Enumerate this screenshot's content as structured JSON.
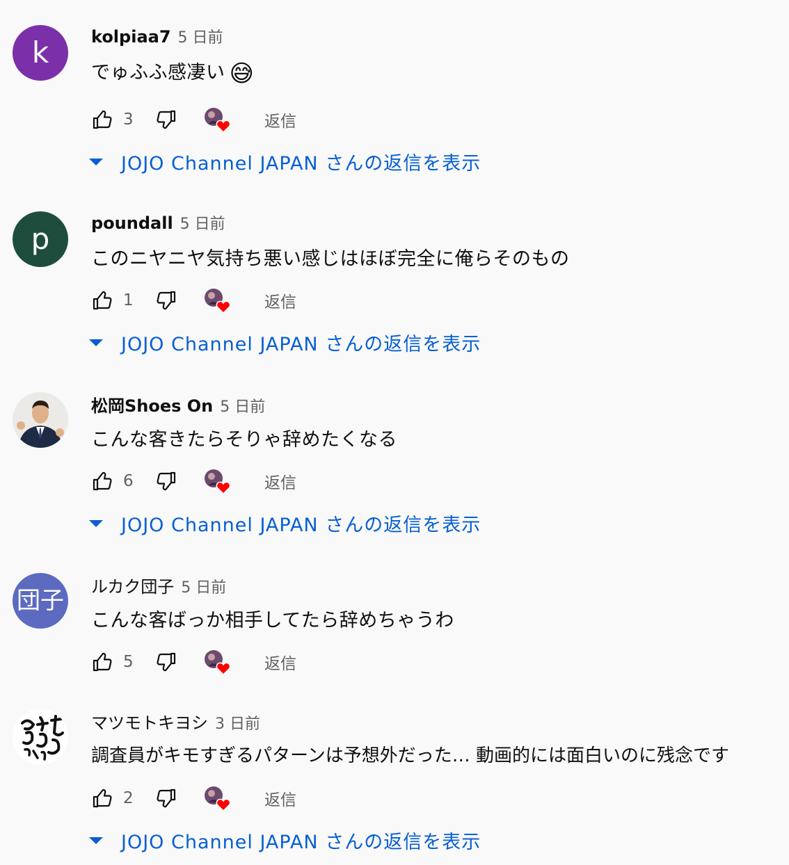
{
  "comments": [
    {
      "author": "kolpiaa7",
      "time": "5 日前",
      "text": "でゅふふ感凄い",
      "emoji": "😅",
      "likes": "3",
      "reply_label": "返信",
      "replies_label": "JOJO Channel JAPAN さんの返信を表示",
      "avatar": {
        "type": "letter",
        "letter": "k",
        "color": "#7b2fa8"
      }
    },
    {
      "author": "poundall",
      "time": "5 日前",
      "text": "このニヤニヤ気持ち悪い感じはほぼ完全に俺らそのもの",
      "likes": "1",
      "reply_label": "返信",
      "replies_label": "JOJO Channel JAPAN さんの返信を表示",
      "avatar": {
        "type": "letter",
        "letter": "p",
        "color": "#1e4d3e"
      }
    },
    {
      "author": "松岡Shoes On",
      "time": "5 日前",
      "text": "こんな客きたらそりゃ辞めたくなる",
      "likes": "6",
      "reply_label": "返信",
      "replies_label": "JOJO Channel JAPAN さんの返信を表示",
      "avatar": {
        "type": "photo",
        "color": "#e8e8e8"
      }
    },
    {
      "author": "ルカク団子",
      "time": "5 日前",
      "text": "こんな客ばっか相手してたら辞めちゃうわ",
      "likes": "5",
      "reply_label": "返信",
      "avatar": {
        "type": "letter",
        "letter": "団子",
        "color": "#5c6bc0"
      }
    },
    {
      "author": "マツモトキヨシ",
      "time": "3 日前",
      "text": "調査員がキモすぎるパターンは予想外だった… 動画的には面白いのに残念です",
      "likes": "2",
      "reply_label": "返信",
      "replies_label": "JOJO Channel JAPAN さんの返信を表示",
      "avatar": {
        "type": "calligraphy",
        "color": "#ffffff"
      }
    }
  ],
  "icons": {
    "like": "thumb-up-icon",
    "dislike": "thumb-down-icon",
    "creator_heart": "creator-heart-icon"
  },
  "colors": {
    "link": "#065fd4",
    "heart": "#ff0000",
    "secondary_text": "#606060"
  }
}
